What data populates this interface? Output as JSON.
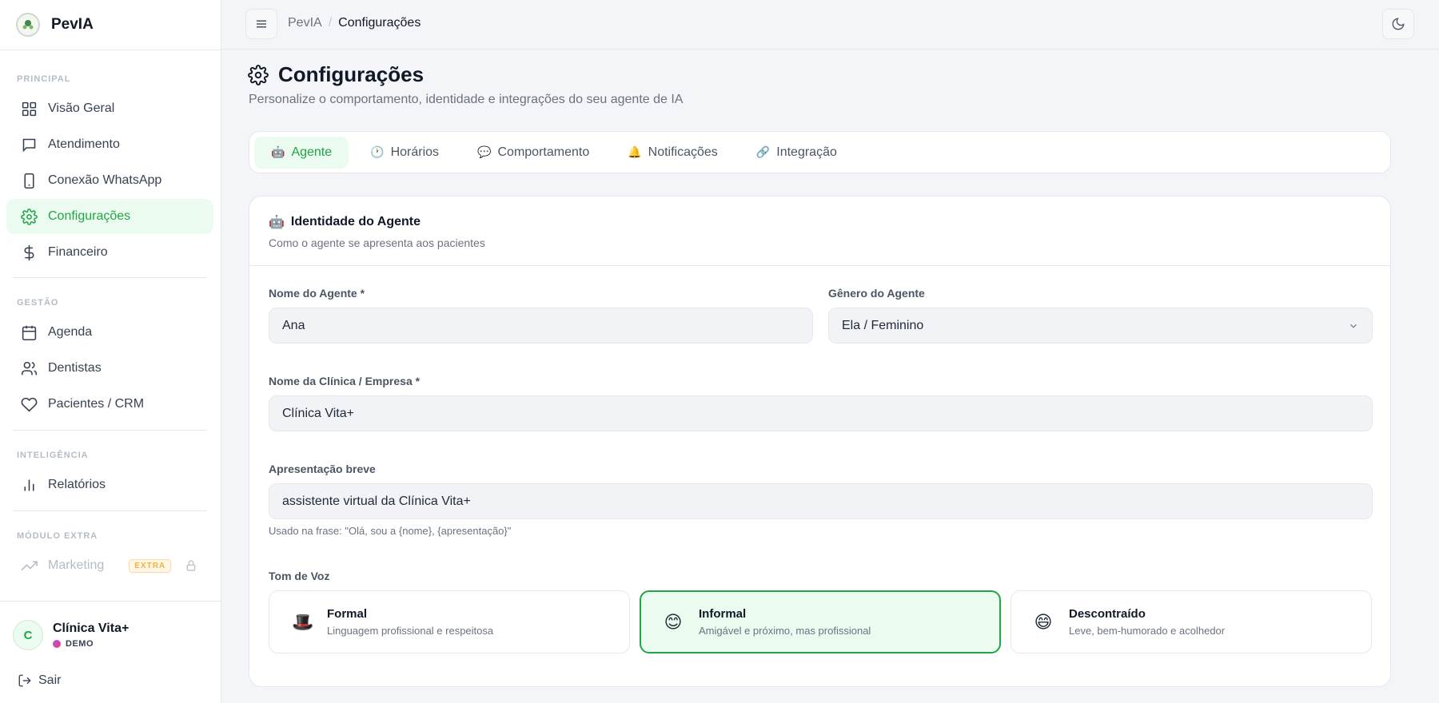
{
  "brand": {
    "name": "PevIA"
  },
  "sidebar": {
    "sections": [
      {
        "label": "PRINCIPAL"
      },
      {
        "label": "GESTÃO"
      },
      {
        "label": "INTELIGÊNCIA"
      },
      {
        "label": "MÓDULO EXTRA"
      }
    ],
    "items": [
      {
        "label": "Visão Geral",
        "icon": "grid-icon"
      },
      {
        "label": "Atendimento",
        "icon": "chat-icon"
      },
      {
        "label": "Conexão WhatsApp",
        "icon": "phone-icon"
      },
      {
        "label": "Configurações",
        "icon": "gear-icon",
        "active": true
      },
      {
        "label": "Financeiro",
        "icon": "dollar-icon"
      },
      {
        "label": "Agenda",
        "icon": "calendar-icon"
      },
      {
        "label": "Dentistas",
        "icon": "users-icon"
      },
      {
        "label": "Pacientes / CRM",
        "icon": "heart-icon"
      },
      {
        "label": "Relatórios",
        "icon": "bar-chart-icon"
      },
      {
        "label": "Marketing",
        "icon": "trending-icon",
        "badge": "EXTRA",
        "locked": true
      }
    ],
    "user": {
      "initial": "C",
      "name": "Clínica Vita+",
      "tag": "DEMO"
    },
    "logout_label": "Sair"
  },
  "topbar": {
    "breadcrumb": {
      "root": "PevIA",
      "separator": "/",
      "current": "Configurações"
    }
  },
  "page": {
    "title": "Configurações",
    "subtitle": "Personalize o comportamento, identidade e integrações do seu agente de IA"
  },
  "tabs": [
    {
      "label": "Agente",
      "icon": "🤖",
      "active": true
    },
    {
      "label": "Horários",
      "icon": "🕐"
    },
    {
      "label": "Comportamento",
      "icon": "💬"
    },
    {
      "label": "Notificações",
      "icon": "🔔"
    },
    {
      "label": "Integração",
      "icon": "🔗"
    }
  ],
  "card": {
    "icon": "🤖",
    "title": "Identidade do Agente",
    "subtitle": "Como o agente se apresenta aos pacientes",
    "fields": {
      "agent_name": {
        "label": "Nome do Agente *",
        "value": "Ana"
      },
      "agent_gender": {
        "label": "Gênero do Agente",
        "value": "Ela / Feminino"
      },
      "clinic_name": {
        "label": "Nome da Clínica / Empresa *",
        "value": "Clínica Vita+"
      },
      "intro": {
        "label": "Apresentação breve",
        "value": "assistente virtual da Clínica Vita+",
        "hint": "Usado na frase: \"Olá, sou a {nome}, {apresentação}\""
      }
    },
    "tone": {
      "label": "Tom de Voz",
      "options": [
        {
          "emoji": "🎩",
          "name": "Formal",
          "desc": "Linguagem profissional e respeitosa"
        },
        {
          "emoji": "😊",
          "name": "Informal",
          "desc": "Amigável e próximo, mas profissional",
          "selected": true
        },
        {
          "emoji": "😄",
          "name": "Descontraído",
          "desc": "Leve, bem-humorado e acolhedor"
        }
      ]
    }
  },
  "colors": {
    "accent": "#22a447",
    "accent_bg": "#ecfbef"
  }
}
